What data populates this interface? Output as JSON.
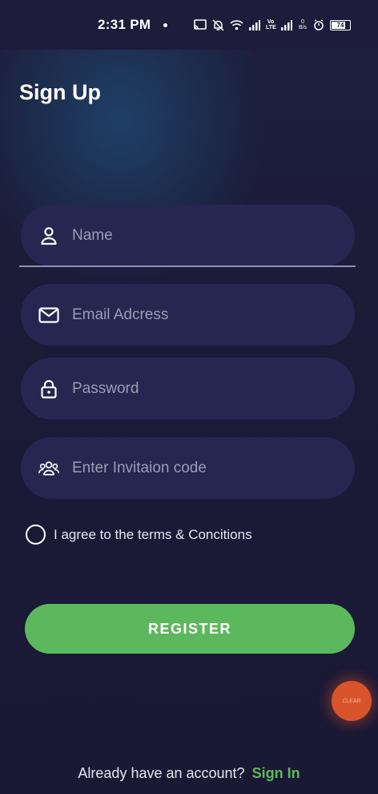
{
  "status_bar": {
    "time": "2:31 PM",
    "volte_label": "Vo LTE",
    "speed_label": "0 B/s",
    "battery_level": "74",
    "icons": [
      "cast-icon",
      "mute-icon",
      "wifi-icon",
      "signal-icon",
      "signal-icon",
      "alarm-icon",
      "battery-icon"
    ]
  },
  "page": {
    "title": "Sign Up"
  },
  "form": {
    "name": {
      "value": "",
      "placeholder": "Name",
      "icon": "person-icon"
    },
    "email": {
      "value": "",
      "placeholder": "Email Adcress",
      "icon": "mail-icon"
    },
    "password": {
      "value": "",
      "placeholder": "Password",
      "icon": "lock-icon"
    },
    "invite": {
      "value": "",
      "placeholder": "Enter Invitaion code",
      "icon": "group-icon"
    },
    "terms_label": "I agree to the terms & Concitions",
    "terms_checked": false,
    "register_label": "REGISTER"
  },
  "footer": {
    "prompt": "Already have an account?",
    "signin_label": "Sign In"
  },
  "floating_button": {
    "label": "CLEAR"
  },
  "colors": {
    "background": "#1b1a37",
    "field_background": "#262650",
    "accent_green": "#5cb85c",
    "text_primary": "#ffffff",
    "placeholder": "#9d9cb3",
    "bubble": "#d9542a"
  }
}
